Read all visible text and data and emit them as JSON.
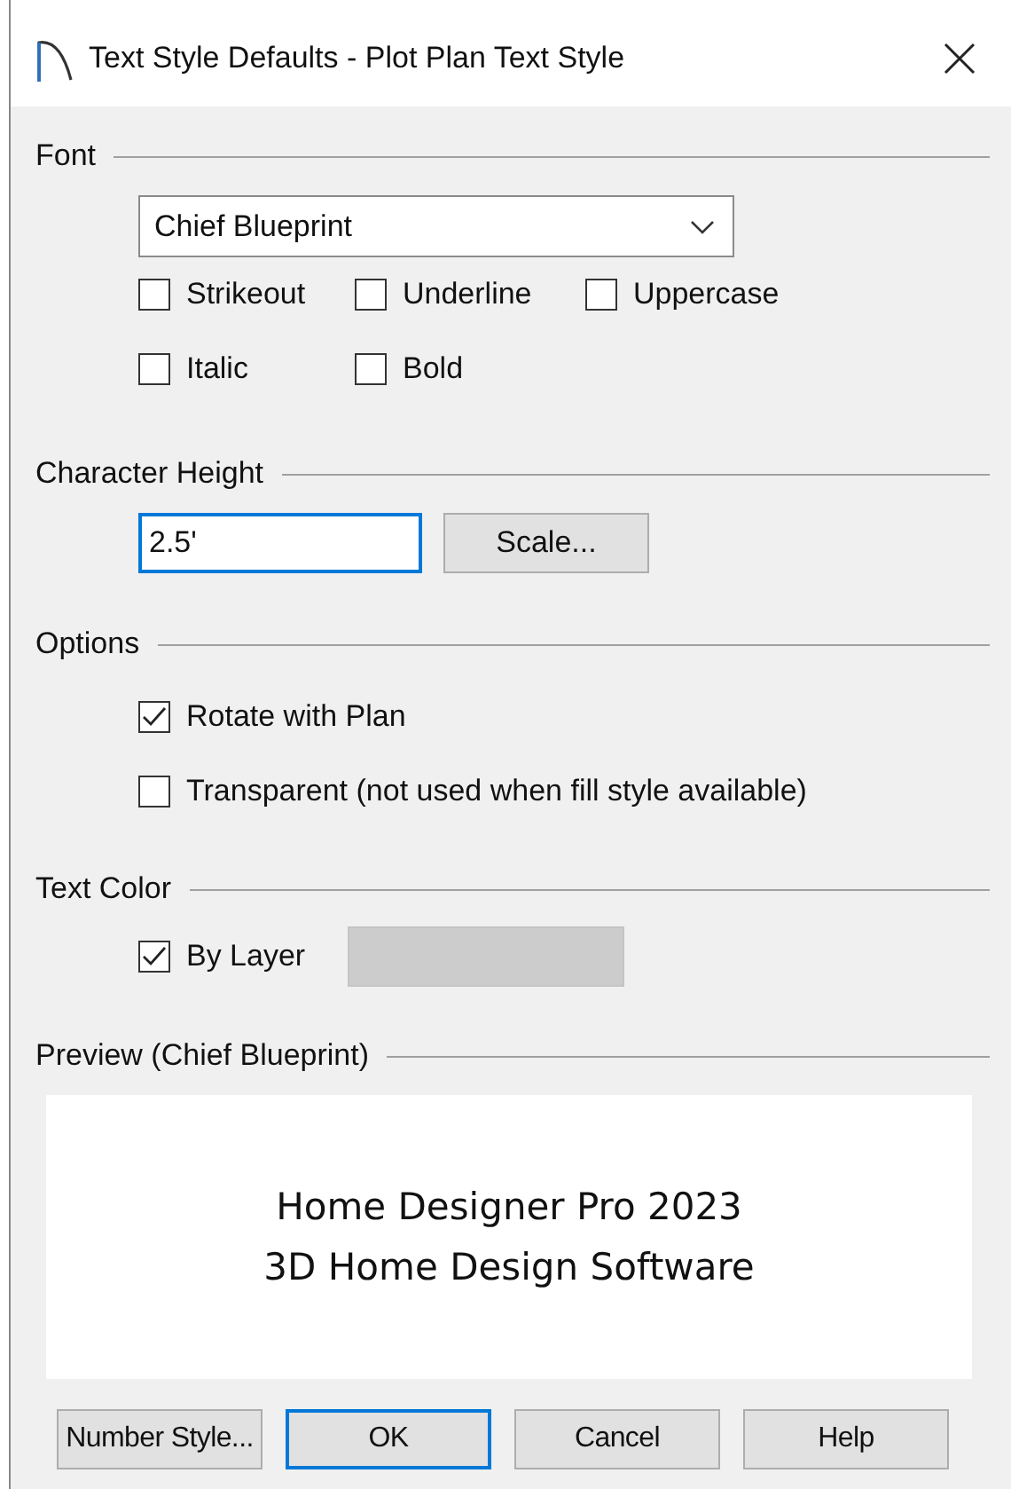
{
  "window": {
    "title": "Text Style Defaults - Plot Plan Text Style"
  },
  "font": {
    "heading": "Font",
    "family": "Chief Blueprint",
    "option_rows": [
      [
        {
          "label": "Strikeout",
          "checked": false
        },
        {
          "label": "Underline",
          "checked": false
        },
        {
          "label": "Uppercase",
          "checked": false
        }
      ],
      [
        {
          "label": "Italic",
          "checked": false
        },
        {
          "label": "Bold",
          "checked": false
        }
      ]
    ]
  },
  "character_height": {
    "heading": "Character Height",
    "value": "2.5'",
    "focused": true,
    "scale_button": "Scale..."
  },
  "options": {
    "heading": "Options",
    "items": [
      {
        "label": "Rotate with Plan",
        "checked": true
      },
      {
        "label": "Transparent (not used when fill style available)",
        "checked": false
      }
    ]
  },
  "text_color": {
    "heading": "Text Color",
    "by_layer": {
      "label": "By Layer",
      "checked": true
    }
  },
  "preview": {
    "heading": "Preview (Chief Blueprint)",
    "lines": [
      "Home Designer Pro 2023",
      "3D Home Design Software"
    ]
  },
  "buttons": [
    {
      "label": "Number Style...",
      "default": false
    },
    {
      "label": "OK",
      "default": true
    },
    {
      "label": "Cancel",
      "default": false
    },
    {
      "label": "Help",
      "default": false
    }
  ]
}
